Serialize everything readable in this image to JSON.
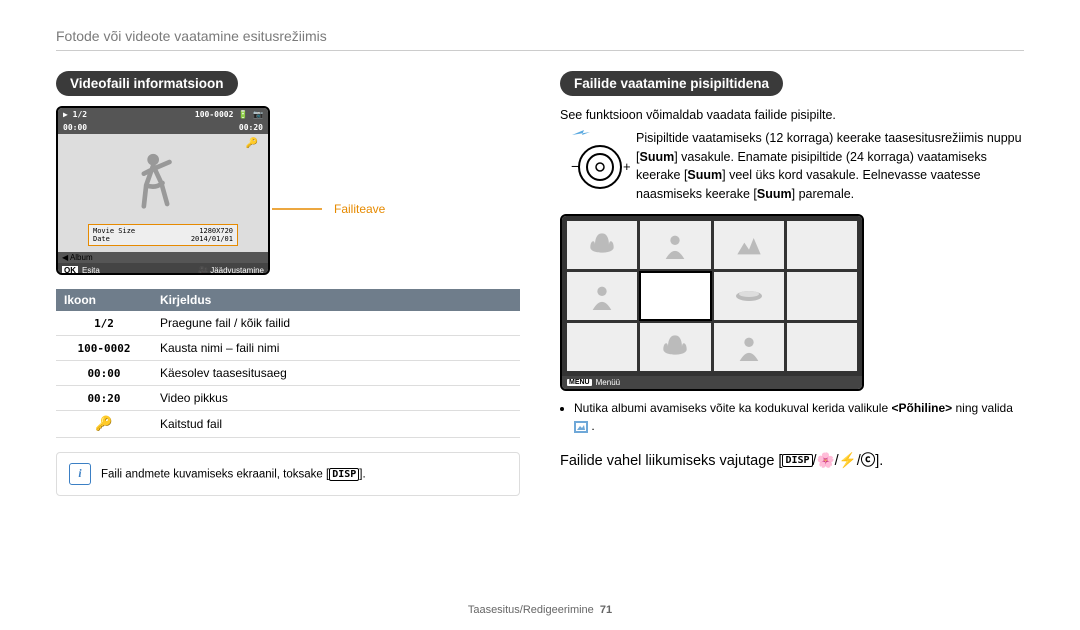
{
  "header": "Fotode või videote vaatamine esitusrežiimis",
  "left": {
    "pill": "Videofaili informatsioon",
    "callout": "Failiteave",
    "ss": {
      "tl": "1/2",
      "tr": "100-0002",
      "tr2": "00:00",
      "tr3": "00:20",
      "movieLabel": "Movie Size",
      "movieVal": "1280X720",
      "dateLabel": "Date",
      "dateVal": "2014/01/01",
      "album": "Album",
      "ok": "OK",
      "esita": "Esita",
      "freeze": "Jäädvustamine"
    },
    "table": {
      "h1": "Ikoon",
      "h2": "Kirjeldus",
      "rows": [
        {
          "icon": "1/2",
          "desc": "Praegune fail / kõik failid"
        },
        {
          "icon": "100-0002",
          "desc": "Kausta nimi – faili nimi"
        },
        {
          "icon": "00:00",
          "desc": "Käesolev taasesitusaeg"
        },
        {
          "icon": "00:20",
          "desc": "Video pikkus"
        },
        {
          "icon": "🔑",
          "desc": "Kaitstud fail"
        }
      ]
    },
    "note": "Faili andmete kuvamiseks ekraanil, toksake [",
    "noteBtn": "DISP",
    "noteEnd": "]."
  },
  "right": {
    "pill": "Failide vaatamine pisipiltidena",
    "intro": "See funktsioon võimaldab vaadata failide pisipilte.",
    "zoomText1": "Pisipiltide vaatamiseks (12 korraga) keerake taasesitusrežiimis nuppu [",
    "zoomText2": "] vasakule. Enamate pisipiltide (24 korraga) vaatamiseks keerake [",
    "zoomText3": "] veel üks kord vasakule. Eelnevasse vaatesse naasmiseks keerake [",
    "zoomText4": "] paremale.",
    "suum": "Suum",
    "menu": "MENU",
    "menuLabel": "Menüü",
    "bullet1a": "Nutika albumi avamiseks võite ka kodukuval kerida valikule ",
    "bullet1b": "<Põhiline>",
    "bullet1c": " ning valida ",
    "navText": "Failide vahel liikumiseks vajutage [",
    "navBtn": "DISP",
    "navEnd": "]."
  },
  "footer": {
    "section": "Taasesitus/Redigeerimine",
    "page": "71"
  }
}
